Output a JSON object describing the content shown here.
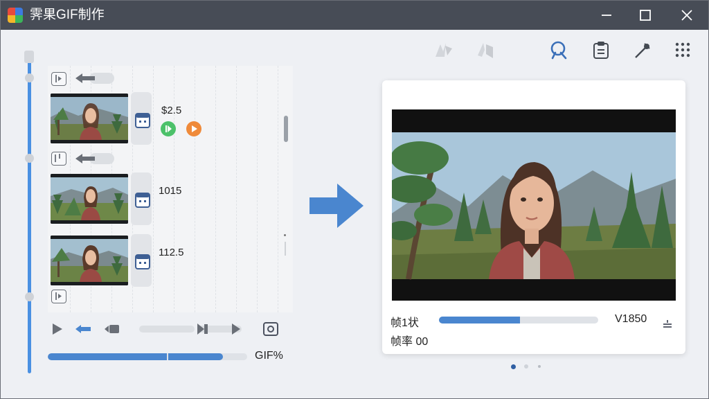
{
  "window": {
    "title": "霁果GIF制作"
  },
  "colors": {
    "accent": "#4a86cf",
    "titlebar": "#474c56",
    "green": "#4cc16a",
    "orange": "#ef8a3a"
  },
  "toolbar": {
    "icons": [
      "magic-disabled-icon",
      "share-disabled-icon",
      "search-icon",
      "clipboard-icon",
      "eyedropper-icon",
      "grid-menu-icon"
    ]
  },
  "clips": [
    {
      "label": "$2.5"
    },
    {
      "label": "1015"
    },
    {
      "label": "112.5"
    }
  ],
  "bottom": {
    "gif_label": "GIF%",
    "progress": 0.88
  },
  "preview": {
    "frame_label": "帧1状",
    "rate_label": "帧率 00",
    "value_label": "V1850",
    "progress": 0.51
  },
  "pager": {
    "count": 3,
    "active": 0
  }
}
